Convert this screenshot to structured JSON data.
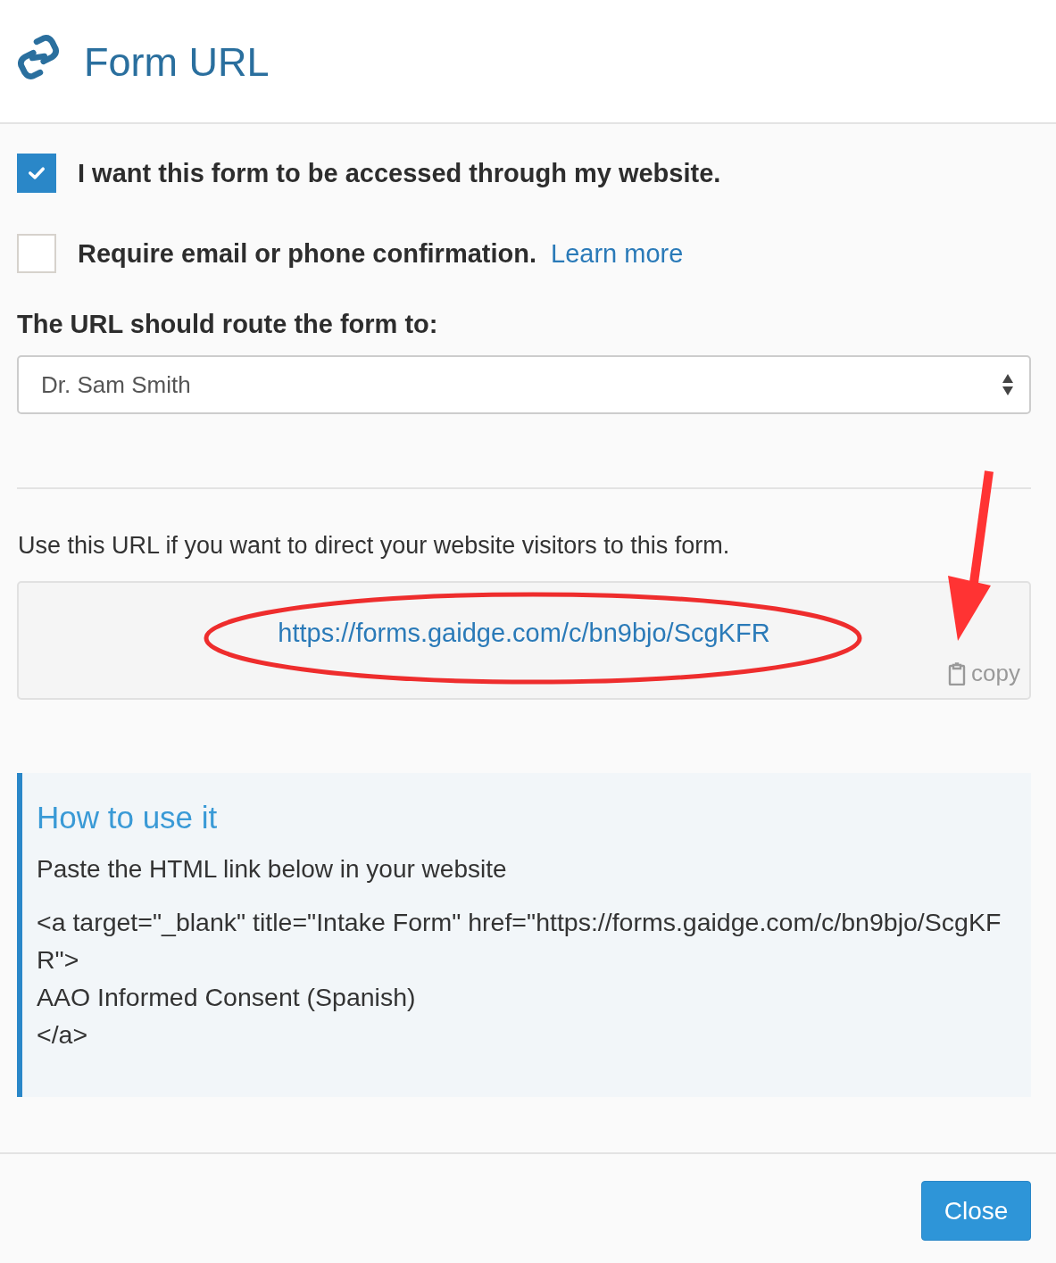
{
  "dialog": {
    "title": "Form URL"
  },
  "options": [
    {
      "label": "I want this form to be accessed through my website.",
      "checked": true
    },
    {
      "label": "Require email or phone confirmation.",
      "checked": false,
      "link": "Learn more"
    }
  ],
  "route": {
    "label": "The URL should route the form to:",
    "value": "Dr. Sam Smith"
  },
  "url_section": {
    "description": "Use this URL if you want to direct your website visitors to this form.",
    "url": "https://forms.gaidge.com/c/bn9bjo/ScgKFR",
    "copy_label": "copy"
  },
  "how_to": {
    "title": "How to use it",
    "instruction": "Paste the HTML link below in your website",
    "code_lines": [
      "<a target=\"_blank\" title=\"Intake Form\" href=\"https://forms.gaidge.com/c/bn9bjo/ScgKFR\">",
      "AAO Informed Consent (Spanish)",
      "</a>"
    ]
  },
  "footer": {
    "close_button": "Close"
  },
  "annotations": [
    {
      "kind": "ellipse"
    },
    {
      "kind": "arrow"
    }
  ]
}
